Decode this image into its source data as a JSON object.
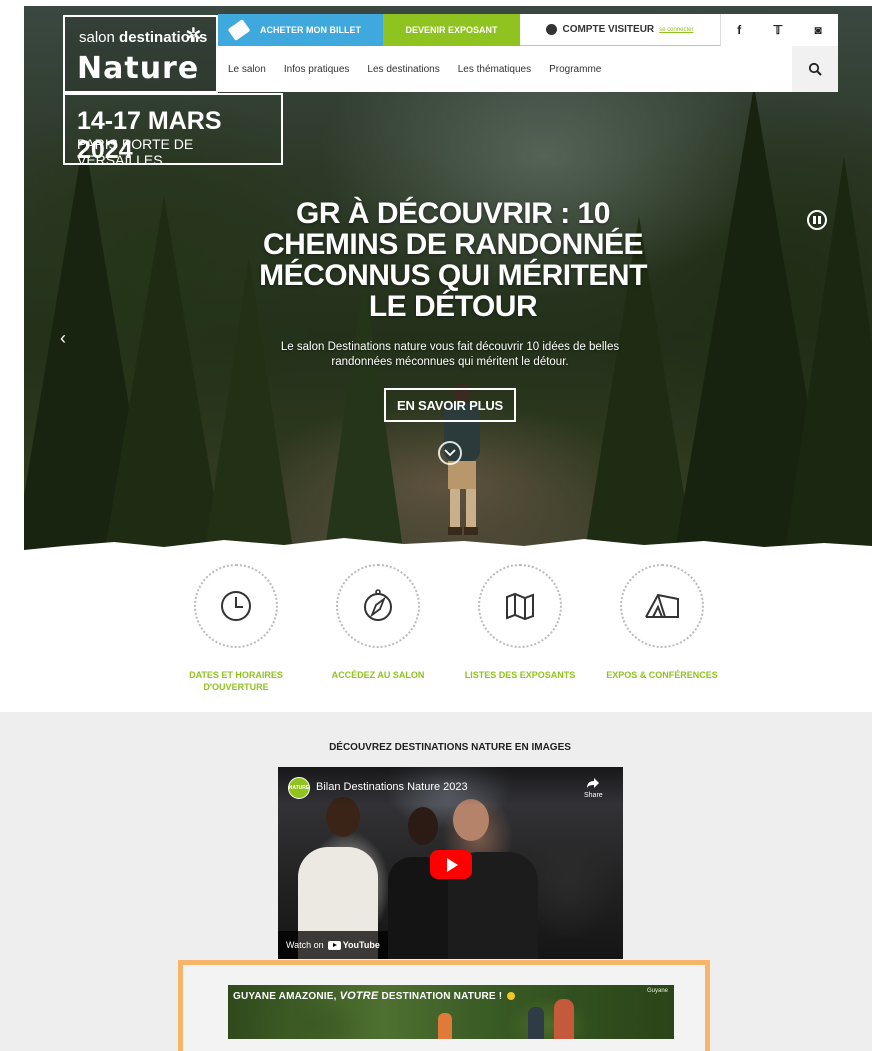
{
  "brand": {
    "logo_prefix": "salon",
    "logo_suffix": "destinations",
    "logo_main": "Nature",
    "dates": "14-17 MARS 2024",
    "venue": "PARIS PORTE DE VERSAILLES"
  },
  "topbar": {
    "ticket_label": "ACHETER MON BILLET",
    "exhibitor_label": "DEVENIR EXPOSANT",
    "account_label": "COMPTE VISITEUR",
    "account_link": "se connecter",
    "social": [
      "f",
      "𝕋",
      "◙"
    ]
  },
  "nav": {
    "items": [
      "Le salon",
      "Infos pratiques",
      "Les destinations",
      "Les thématiques",
      "Programme"
    ]
  },
  "hero": {
    "title": "GR À DÉCOUVRIR : 10 CHEMINS DE RANDONNÉE MÉCONNUS QUI MÉRITENT LE DÉTOUR",
    "text": "Le salon Destinations nature vous fait découvrir 10 idées de belles randonnées méconnues qui méritent le détour.",
    "button": "EN SAVOIR PLUS",
    "prev_glyph": "‹"
  },
  "quick_links": [
    {
      "label": "DATES ET HORAIRES D'OUVERTURE",
      "icon": "clock-icon"
    },
    {
      "label": "ACCÉDEZ AU SALON",
      "icon": "compass-icon"
    },
    {
      "label": "LISTES DES EXPOSANTS",
      "icon": "map-icon"
    },
    {
      "label": "EXPOS & CONFÉRENCES",
      "icon": "tent-icon"
    }
  ],
  "images_section": {
    "title": "DÉCOUVREZ DESTINATIONS NATURE EN IMAGES"
  },
  "video": {
    "channel_badge": "NATURE",
    "title": "Bilan Destinations Nature 2023",
    "share_label": "Share",
    "watch_on": "Watch on",
    "youtube": "YouTube"
  },
  "ad": {
    "text_before": "GUYANE AMAZONIE,",
    "text_em": "VOTRE",
    "text_after": "DESTINATION NATURE !",
    "logo": "Guyane"
  },
  "colors": {
    "ticket_blue": "#3fa8dc",
    "exhibitor_green": "#8fc320",
    "accent_green": "#8fc320",
    "ad_border": "#f6b56a"
  }
}
